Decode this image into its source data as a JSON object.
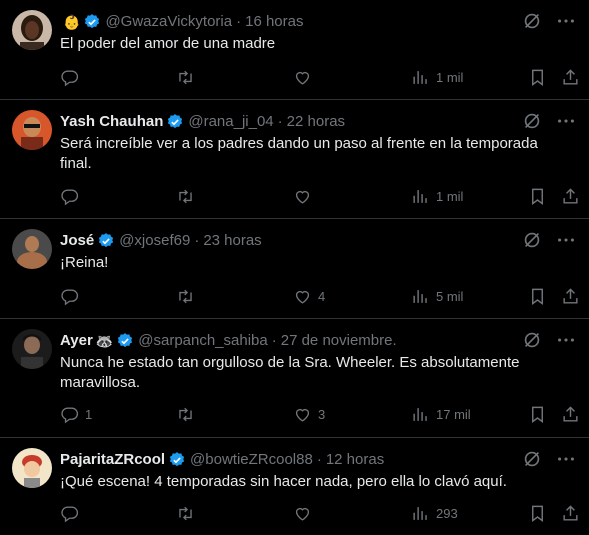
{
  "colors": {
    "background": "#000000",
    "divider": "#2f3336",
    "text_primary": "#e7e9ea",
    "text_secondary": "#71767b",
    "verified_blue": "#1d9bf0"
  },
  "icons": {
    "reply": "reply-icon",
    "retweet": "retweet-icon",
    "like": "like-icon",
    "views": "views-icon",
    "bookmark": "bookmark-icon",
    "share": "share-icon",
    "grok": "grok-icon",
    "more": "more-icon",
    "verified": "verified-badge-icon"
  },
  "tweets": [
    {
      "name": "",
      "badge": "👶",
      "handle": "@GwazaVickytoria",
      "time": "16 horas",
      "text": "El poder del amor de una madre",
      "replies": "",
      "retweets": "",
      "likes": "",
      "views": "1 mil"
    },
    {
      "name": "Yash Chauhan",
      "badge": "",
      "handle": "@rana_ji_04",
      "time": "22 horas",
      "text": "Será increíble ver a los padres dando un paso al frente en la temporada final.",
      "replies": "",
      "retweets": "",
      "likes": "",
      "views": "1 mil"
    },
    {
      "name": "José",
      "badge": "",
      "handle": "@xjosef69",
      "time": "23 horas",
      "text": "¡Reina!",
      "replies": "",
      "retweets": "",
      "likes": "4",
      "views": "5 mil"
    },
    {
      "name": "Ayer",
      "badge": "🦝",
      "handle": "@sarpanch_sahiba",
      "time": "27 de noviembre.",
      "text": "Nunca he estado tan orgulloso de la Sra. Wheeler. Es absolutamente maravillosa.",
      "replies": "1",
      "retweets": "",
      "likes": "3",
      "views": "17 mil"
    },
    {
      "name": "PajaritaZRcool",
      "badge": "",
      "handle": "@bowtieZRcool88",
      "time": "12 horas",
      "text": "¡Qué escena! 4 temporadas sin hacer nada, pero ella lo clavó aquí.",
      "replies": "",
      "retweets": "",
      "likes": "",
      "views": "293"
    }
  ]
}
